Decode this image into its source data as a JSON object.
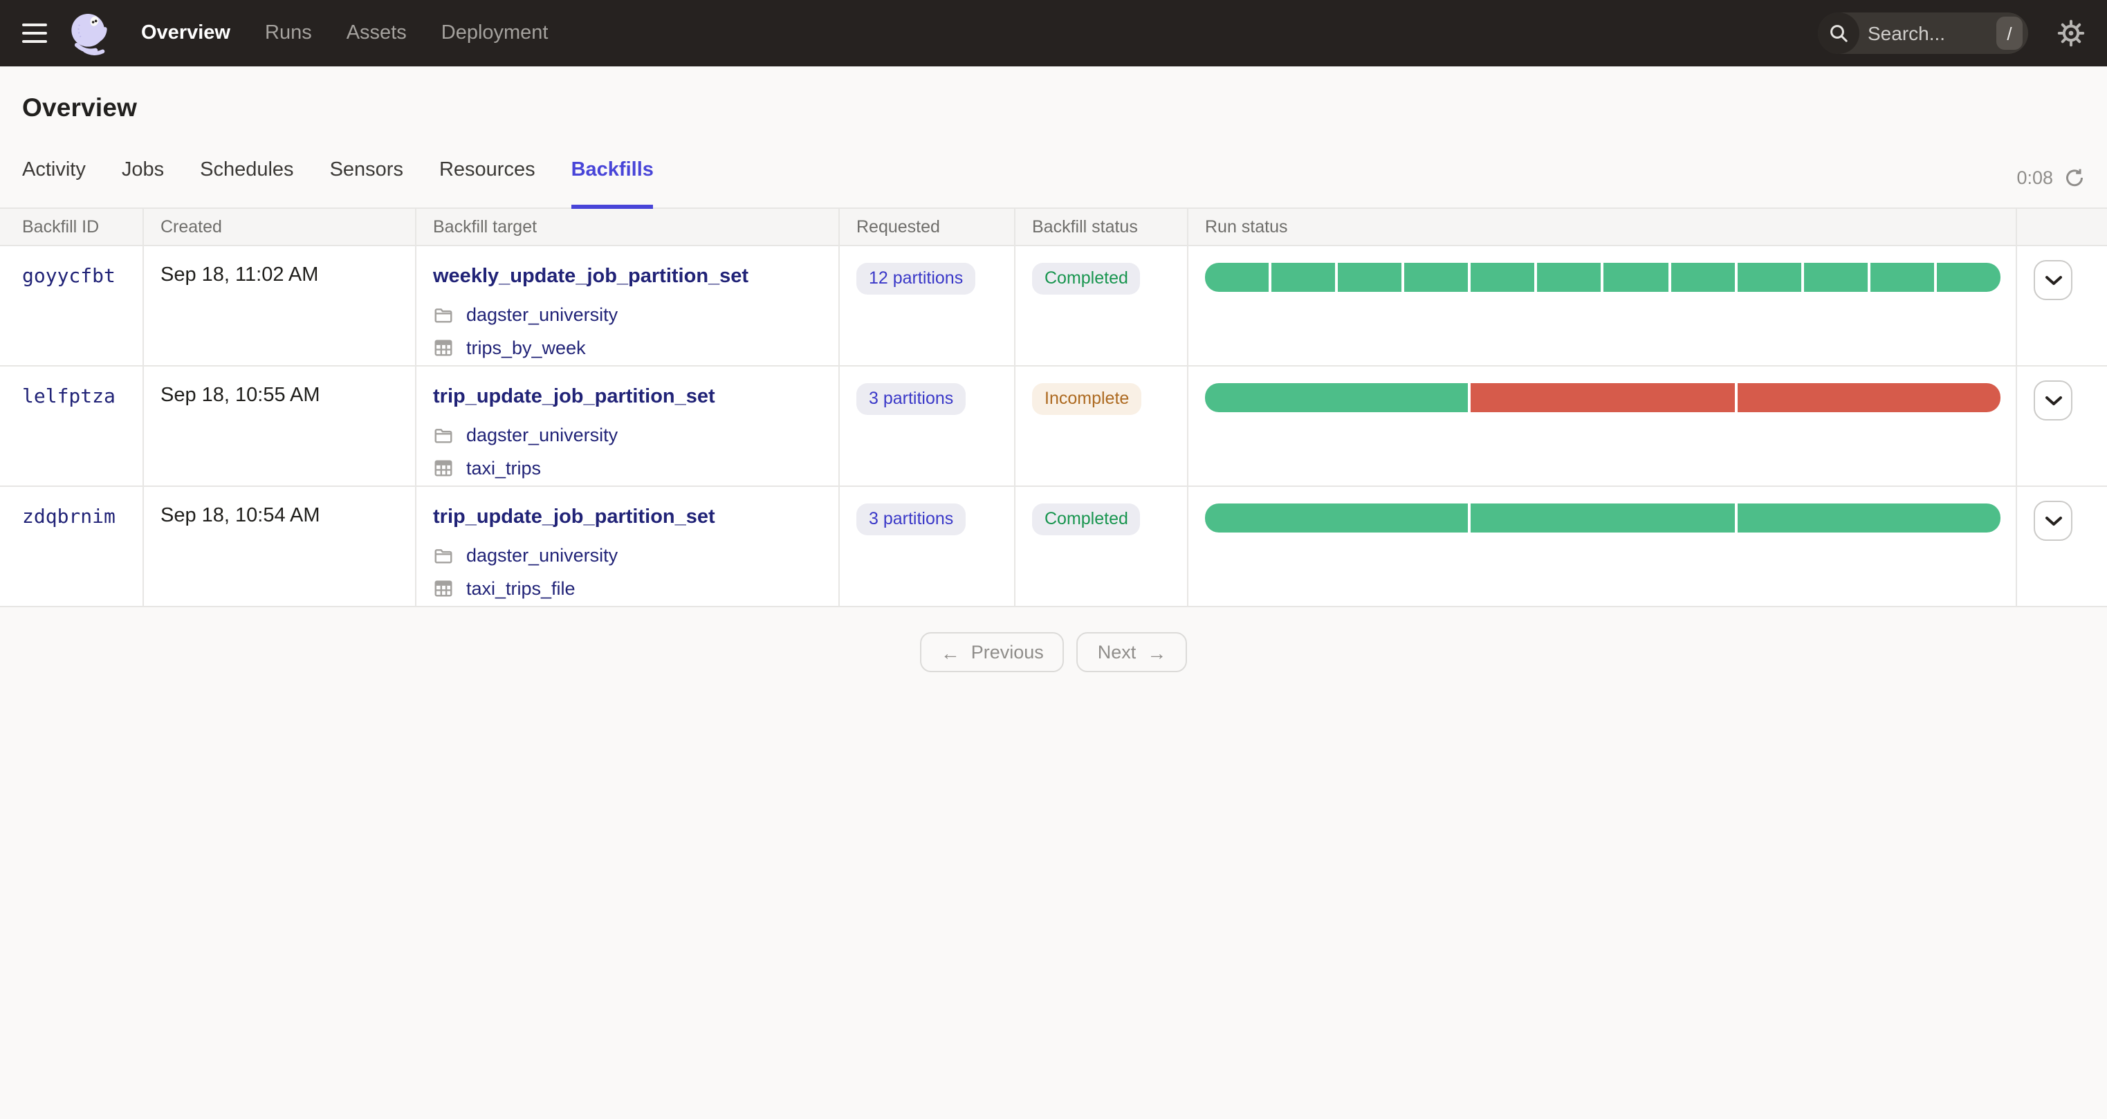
{
  "colors": {
    "accent": "#4845D8",
    "success": "#4DBE89",
    "failure": "#D65B4B",
    "link_navy": "#212377",
    "requested_text": "#3A38C8",
    "completed_text": "#18954F",
    "incomplete_text": "#AD6A21",
    "incomplete_bg": "#F9F0E5",
    "badge_bg": "#ECECF2",
    "topnav_bg": "#262220"
  },
  "nav": {
    "items": [
      {
        "label": "Overview",
        "active": true
      },
      {
        "label": "Runs",
        "active": false
      },
      {
        "label": "Assets",
        "active": false
      },
      {
        "label": "Deployment",
        "active": false
      }
    ],
    "search": {
      "placeholder": "Search...",
      "shortcut": "/"
    }
  },
  "page": {
    "title": "Overview",
    "timer": "0:08"
  },
  "tabs": [
    {
      "label": "Activity",
      "active": false
    },
    {
      "label": "Jobs",
      "active": false
    },
    {
      "label": "Schedules",
      "active": false
    },
    {
      "label": "Sensors",
      "active": false
    },
    {
      "label": "Resources",
      "active": false
    },
    {
      "label": "Backfills",
      "active": true
    }
  ],
  "table": {
    "headers": [
      "Backfill ID",
      "Created",
      "Backfill target",
      "Requested",
      "Backfill status",
      "Run status"
    ],
    "rows": [
      {
        "id": "goyycfbt",
        "created": "Sep 18, 11:02 AM",
        "job": "weekly_update_job_partition_set",
        "location": "dagster_university",
        "partition_set": "trips_by_week",
        "requested": "12 partitions",
        "status_label": "Completed",
        "status_type": "completed",
        "run_segments": [
          "success",
          "success",
          "success",
          "success",
          "success",
          "success",
          "success",
          "success",
          "success",
          "success",
          "success",
          "success"
        ]
      },
      {
        "id": "lelfptza",
        "created": "Sep 18, 10:55 AM",
        "job": "trip_update_job_partition_set",
        "location": "dagster_university",
        "partition_set": "taxi_trips",
        "requested": "3 partitions",
        "status_label": "Incomplete",
        "status_type": "incomplete",
        "run_segments": [
          "success",
          "failure",
          "failure"
        ]
      },
      {
        "id": "zdqbrnim",
        "created": "Sep 18, 10:54 AM",
        "job": "trip_update_job_partition_set",
        "location": "dagster_university",
        "partition_set": "taxi_trips_file",
        "requested": "3 partitions",
        "status_label": "Completed",
        "status_type": "completed",
        "run_segments": [
          "success",
          "success",
          "success"
        ]
      }
    ]
  },
  "pagination": {
    "previous": "Previous",
    "next": "Next",
    "prev_arrow": "←",
    "next_arrow": "→"
  }
}
